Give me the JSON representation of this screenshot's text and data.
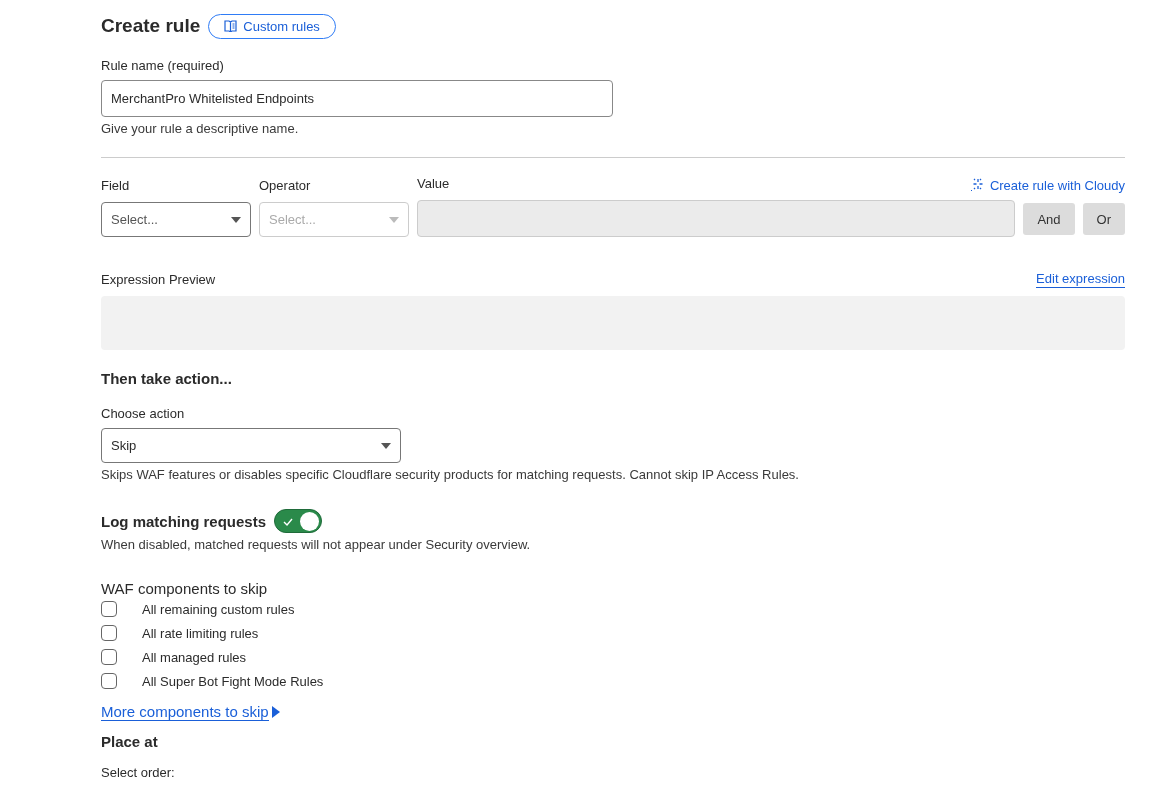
{
  "header": {
    "title": "Create rule",
    "docs_button": "Custom rules"
  },
  "rule_name": {
    "label": "Rule name (required)",
    "value": "MerchantPro Whitelisted Endpoints",
    "help": "Give your rule a descriptive name."
  },
  "builder": {
    "ai_link": "Create rule with Cloudy",
    "fields": [
      {
        "label": "Field",
        "placeholder": "Select...",
        "kind": "select",
        "disabled": false
      },
      {
        "label": "Operator",
        "placeholder": "Select...",
        "kind": "select",
        "disabled": true
      },
      {
        "label": "Value",
        "kind": "text",
        "disabled": true
      }
    ],
    "buttons": [
      "And",
      "Or"
    ]
  },
  "expression": {
    "label": "Expression Preview",
    "edit_link": "Edit expression"
  },
  "action": {
    "heading": "Then take action...",
    "label": "Choose action",
    "value": "Skip",
    "help": "Skips WAF features or disables specific Cloudflare security products for matching requests. Cannot skip IP Access Rules."
  },
  "logging": {
    "label": "Log matching requests",
    "on": true,
    "help": "When disabled, matched requests will not appear under Security overview."
  },
  "skip": {
    "heading": "WAF components to skip",
    "options": [
      {
        "label": "All remaining custom rules",
        "checked": false
      },
      {
        "label": "All rate limiting rules",
        "checked": false
      },
      {
        "label": "All managed rules",
        "checked": false
      },
      {
        "label": "All Super Bot Fight Mode Rules",
        "checked": false
      }
    ],
    "more_link": "More components to skip"
  },
  "place": {
    "heading": "Place at",
    "label": "Select order:"
  }
}
